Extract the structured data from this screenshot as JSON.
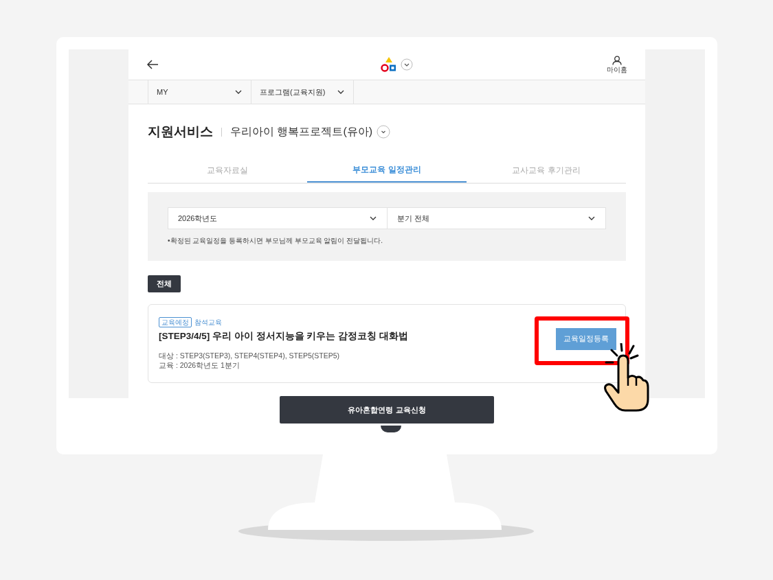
{
  "header": {
    "account_label": "마이홈"
  },
  "nav": [
    {
      "label": "MY"
    },
    {
      "label": "프로그램(교육지원)"
    }
  ],
  "page_title": "지원서비스",
  "subtitle": "우리아이 행복프로젝트(유아)",
  "tabs": [
    {
      "label": "교육자료실",
      "selected": false
    },
    {
      "label": "부모교육 일정관리",
      "selected": true
    },
    {
      "label": "교사교육 후기관리",
      "selected": false
    }
  ],
  "filters": {
    "year": "2026학년도",
    "quarter": "분기 전체",
    "notice": "•확정된 교육일정을 등록하시면 부모님께 부모교육 알림이 전달됩니다."
  },
  "chips": [
    {
      "label": "전체",
      "selected": true
    }
  ],
  "cards": [
    {
      "status": "교육예정",
      "type": "참석교육",
      "title": "[STEP3/4/5] 우리 아이 정서지능을 키우는 감정코칭 대화법",
      "target": "대상 : STEP3(STEP3), STEP4(STEP4), STEP5(STEP5)",
      "schedule": "교육 : 2026학년도 1분기",
      "action": "교육일정등록",
      "highlighted": true
    }
  ],
  "apply_button": "유아혼합연령 교육신청"
}
